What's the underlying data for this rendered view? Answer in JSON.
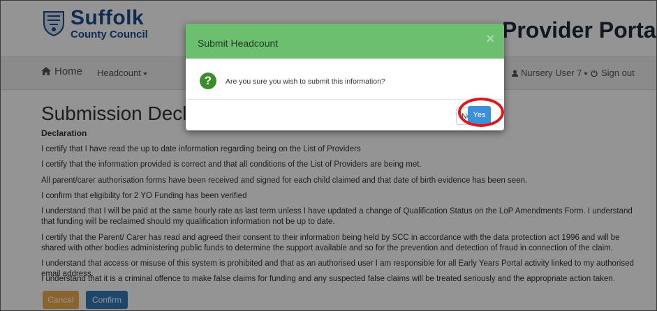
{
  "branding": {
    "logo_main": "Suffolk",
    "logo_sub": "County Council",
    "portal_title": "Provider Portal",
    "brand_color": "#1b4a8c"
  },
  "nav": {
    "home_label": "Home",
    "headcount_label": "Headcount",
    "user_label": "Nursery User 7",
    "signout_label": "Sign out",
    "icons": [
      "home-icon",
      "user-icon",
      "power-icon"
    ]
  },
  "page": {
    "heading": "Submission Declarat",
    "declaration_label": "Declaration",
    "lines": [
      "I certify that I have read the up to date information regarding being on the List of Providers",
      "I certify that the information provided is correct and that all conditions of the List of Providers are being met.",
      "All parent/carer authorisation forms have been received and signed for each child claimed and that date of birth evidence has been seen.",
      "I confirm that eligibility for 2 YO Funding has been verified",
      "I understand that I will be paid at the same hourly rate as last term unless I have updated a change of Qualification Status on the LoP Amendments Form. I understand that funding will be reclaimed should my qualification information not be up to date.",
      "I certify that the Parent/ Carer has read and agreed their consent to their information being held by SCC in accordance with the data protection act 1996 and will be shared with other bodies administering public funds to determine the support available and so for the prevention and detection of fraud in connection of the claim.",
      "I understand that access or misuse of this system is prohibited and that as an authorised user I am responsible for all Early Years Portal activity linked to my authorised email address.",
      "I understand that it is a criminal offence to make false claims for funding and any suspected false claims will be treated seriously and the appropriate action taken."
    ],
    "cancel_label": "Cancel",
    "confirm_label": "Confirm"
  },
  "modal": {
    "title": "Submit Headcount",
    "close_glyph": "×",
    "icon": "question-icon",
    "message": "Are you sure you wish to submit this information?",
    "no_label": "No",
    "yes_label": "Yes",
    "header_color": "#6bbf6f",
    "highlight_color": "#e0161b"
  }
}
